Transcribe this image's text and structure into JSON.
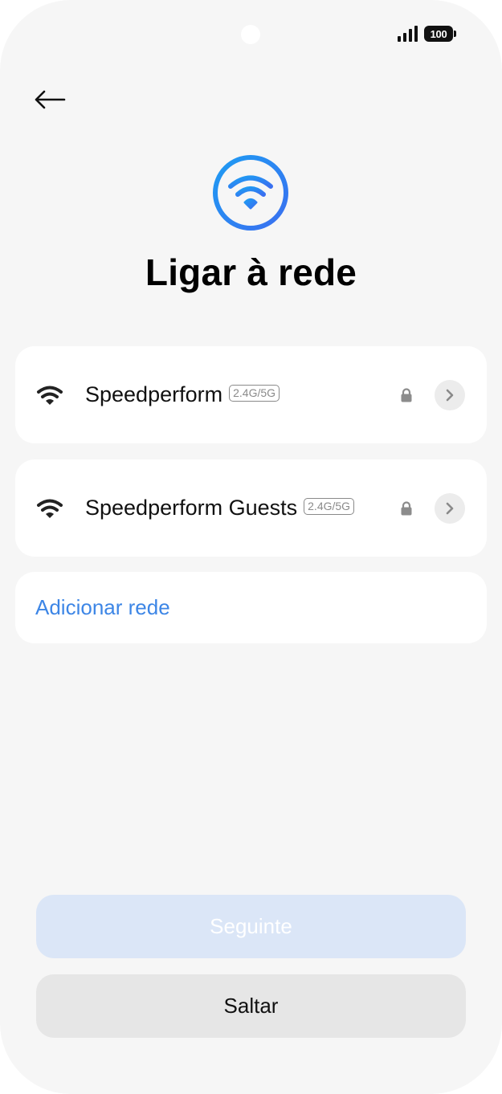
{
  "status_bar": {
    "battery_level": "100"
  },
  "page": {
    "title": "Ligar à rede"
  },
  "networks": [
    {
      "name": "Speedperform",
      "band": "2.4G/5G",
      "secured": true
    },
    {
      "name": "Speedperform Guests",
      "band": "2.4G/5G",
      "secured": true
    }
  ],
  "add_network": {
    "label": "Adicionar rede"
  },
  "buttons": {
    "next_label": "Seguinte",
    "skip_label": "Saltar"
  },
  "colors": {
    "accent": "#3d86e6",
    "next_disabled_bg": "#dbe6f7",
    "skip_bg": "#e6e6e6",
    "page_bg": "#f6f6f6"
  },
  "icons": {
    "back": "arrow-left-icon",
    "hero": "wifi-circle-icon",
    "network": "wifi-icon",
    "secured": "lock-icon",
    "details": "chevron-right-icon"
  }
}
